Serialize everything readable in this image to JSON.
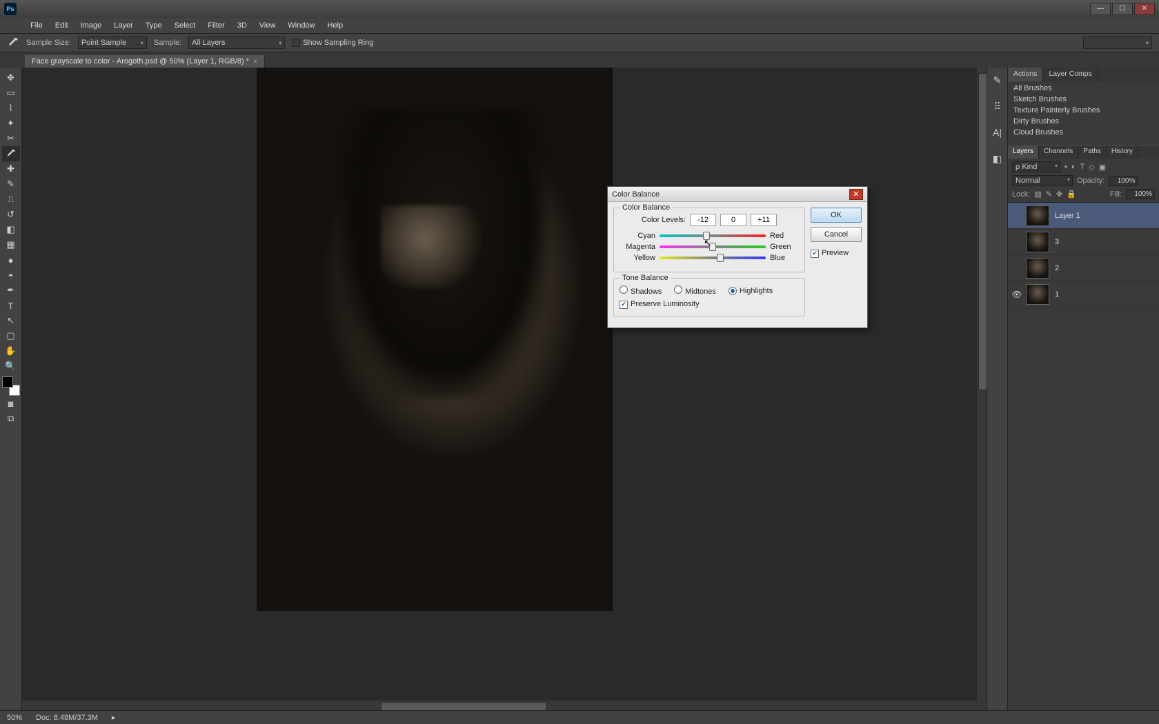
{
  "app": {
    "logo": "Ps"
  },
  "menu": [
    "File",
    "Edit",
    "Image",
    "Layer",
    "Type",
    "Select",
    "Filter",
    "3D",
    "View",
    "Window",
    "Help"
  ],
  "options": {
    "sample_size_label": "Sample Size:",
    "sample_size_value": "Point Sample",
    "sample_label": "Sample:",
    "sample_value": "All Layers",
    "show_ring_label": "Show Sampling Ring"
  },
  "document": {
    "tab_title": "Face grayscale to color - Arogoth.psd @ 50% (Layer 1, RGB/8) *"
  },
  "status": {
    "zoom": "50%",
    "doc_info": "Doc: 8.48M/37.3M"
  },
  "panels": {
    "right_tabs": [
      "Actions",
      "Layer Comps"
    ],
    "brushes": [
      "All Brushes",
      "Sketch Brushes",
      "Texture Painterly Brushes",
      "Dirty Brushes",
      "Cloud Brushes"
    ],
    "layer_tabs": [
      "Layers",
      "Channels",
      "Paths",
      "History"
    ],
    "layer_kind_label": "ρ Kind",
    "blend_mode": "Normal",
    "opacity_label": "Opacity:",
    "opacity_value": "100%",
    "lock_label": "Lock:",
    "fill_label": "Fill:",
    "fill_value": "100%",
    "layers": [
      {
        "name": "Layer 1",
        "visible": false,
        "selected": true
      },
      {
        "name": "3",
        "visible": false,
        "selected": false
      },
      {
        "name": "2",
        "visible": false,
        "selected": false
      },
      {
        "name": "1",
        "visible": true,
        "selected": false
      }
    ]
  },
  "dialog": {
    "title": "Color Balance",
    "group_cb": "Color Balance",
    "levels_label": "Color Levels:",
    "levels": [
      "-12",
      "0",
      "+11"
    ],
    "sliders": [
      {
        "left": "Cyan",
        "right": "Red",
        "pos": 44
      },
      {
        "left": "Magenta",
        "right": "Green",
        "pos": 50
      },
      {
        "left": "Yellow",
        "right": "Blue",
        "pos": 57
      }
    ],
    "group_tb": "Tone Balance",
    "tones": {
      "shadows": "Shadows",
      "midtones": "Midtones",
      "highlights": "Highlights",
      "selected": "highlights"
    },
    "preserve": "Preserve Luminosity",
    "ok": "OK",
    "cancel": "Cancel",
    "preview": "Preview"
  }
}
